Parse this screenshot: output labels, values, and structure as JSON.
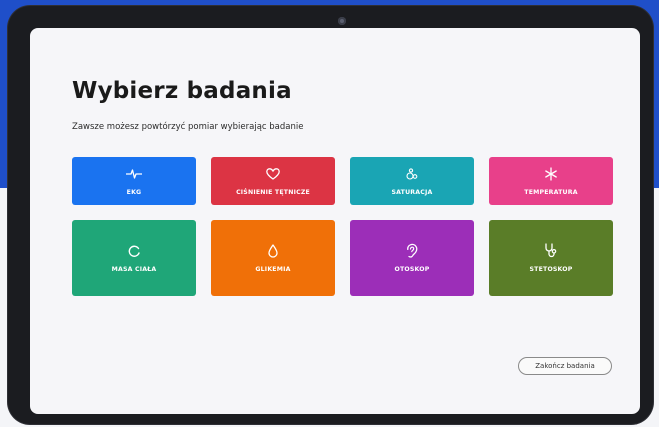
{
  "screen": {
    "title": "Wybierz badania",
    "subtitle": "Zawsze możesz powtórzyć pomiar wybierając badanie"
  },
  "tiles": [
    {
      "label": "EKG",
      "icon": "ekg-pulse-icon",
      "color": "#1a73f0"
    },
    {
      "label": "CIŚNIENIE TĘTNICZE",
      "icon": "heart-icon",
      "color": "#dc3444"
    },
    {
      "label": "SATURACJA",
      "icon": "saturation-bubbles-icon",
      "color": "#1aa5b4"
    },
    {
      "label": "TEMPERATURA",
      "icon": "snowflake-icon",
      "color": "#e8408a"
    },
    {
      "label": "MASA CIAŁA",
      "icon": "scale-gauge-icon",
      "color": "#1fa678"
    },
    {
      "label": "GLIKEMIA",
      "icon": "drop-icon",
      "color": "#f07008"
    },
    {
      "label": "OTOSKOP",
      "icon": "ear-icon",
      "color": "#9c2eb8"
    },
    {
      "label": "STETOSKOP",
      "icon": "stethoscope-icon",
      "color": "#5a7d28"
    }
  ],
  "end_button": {
    "label": "Zakończ badania"
  }
}
